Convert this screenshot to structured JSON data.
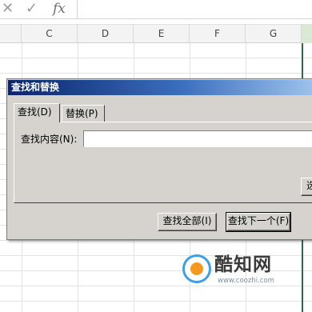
{
  "formula_bar": {
    "cancel_icon": "✕",
    "enter_icon": "✓",
    "fx_label": "fx"
  },
  "columns": [
    "C",
    "D",
    "E",
    "F",
    "G"
  ],
  "dialog": {
    "title": "查找和替换",
    "tabs": [
      {
        "label": "查找(D)",
        "active": true
      },
      {
        "label": "替换(P)",
        "active": false
      }
    ],
    "find_label": "查找内容(N):",
    "find_value": "",
    "options_button": "选",
    "find_all_button": "查找全部(I)",
    "find_next_button": "查找下一个(F)"
  },
  "watermark": {
    "name": "酷知网",
    "url": "www.coozhi.com"
  },
  "colors": {
    "title_bar_start": "#0a246a",
    "dialog_bg": "#d6d3ce",
    "selection": "#217346"
  }
}
